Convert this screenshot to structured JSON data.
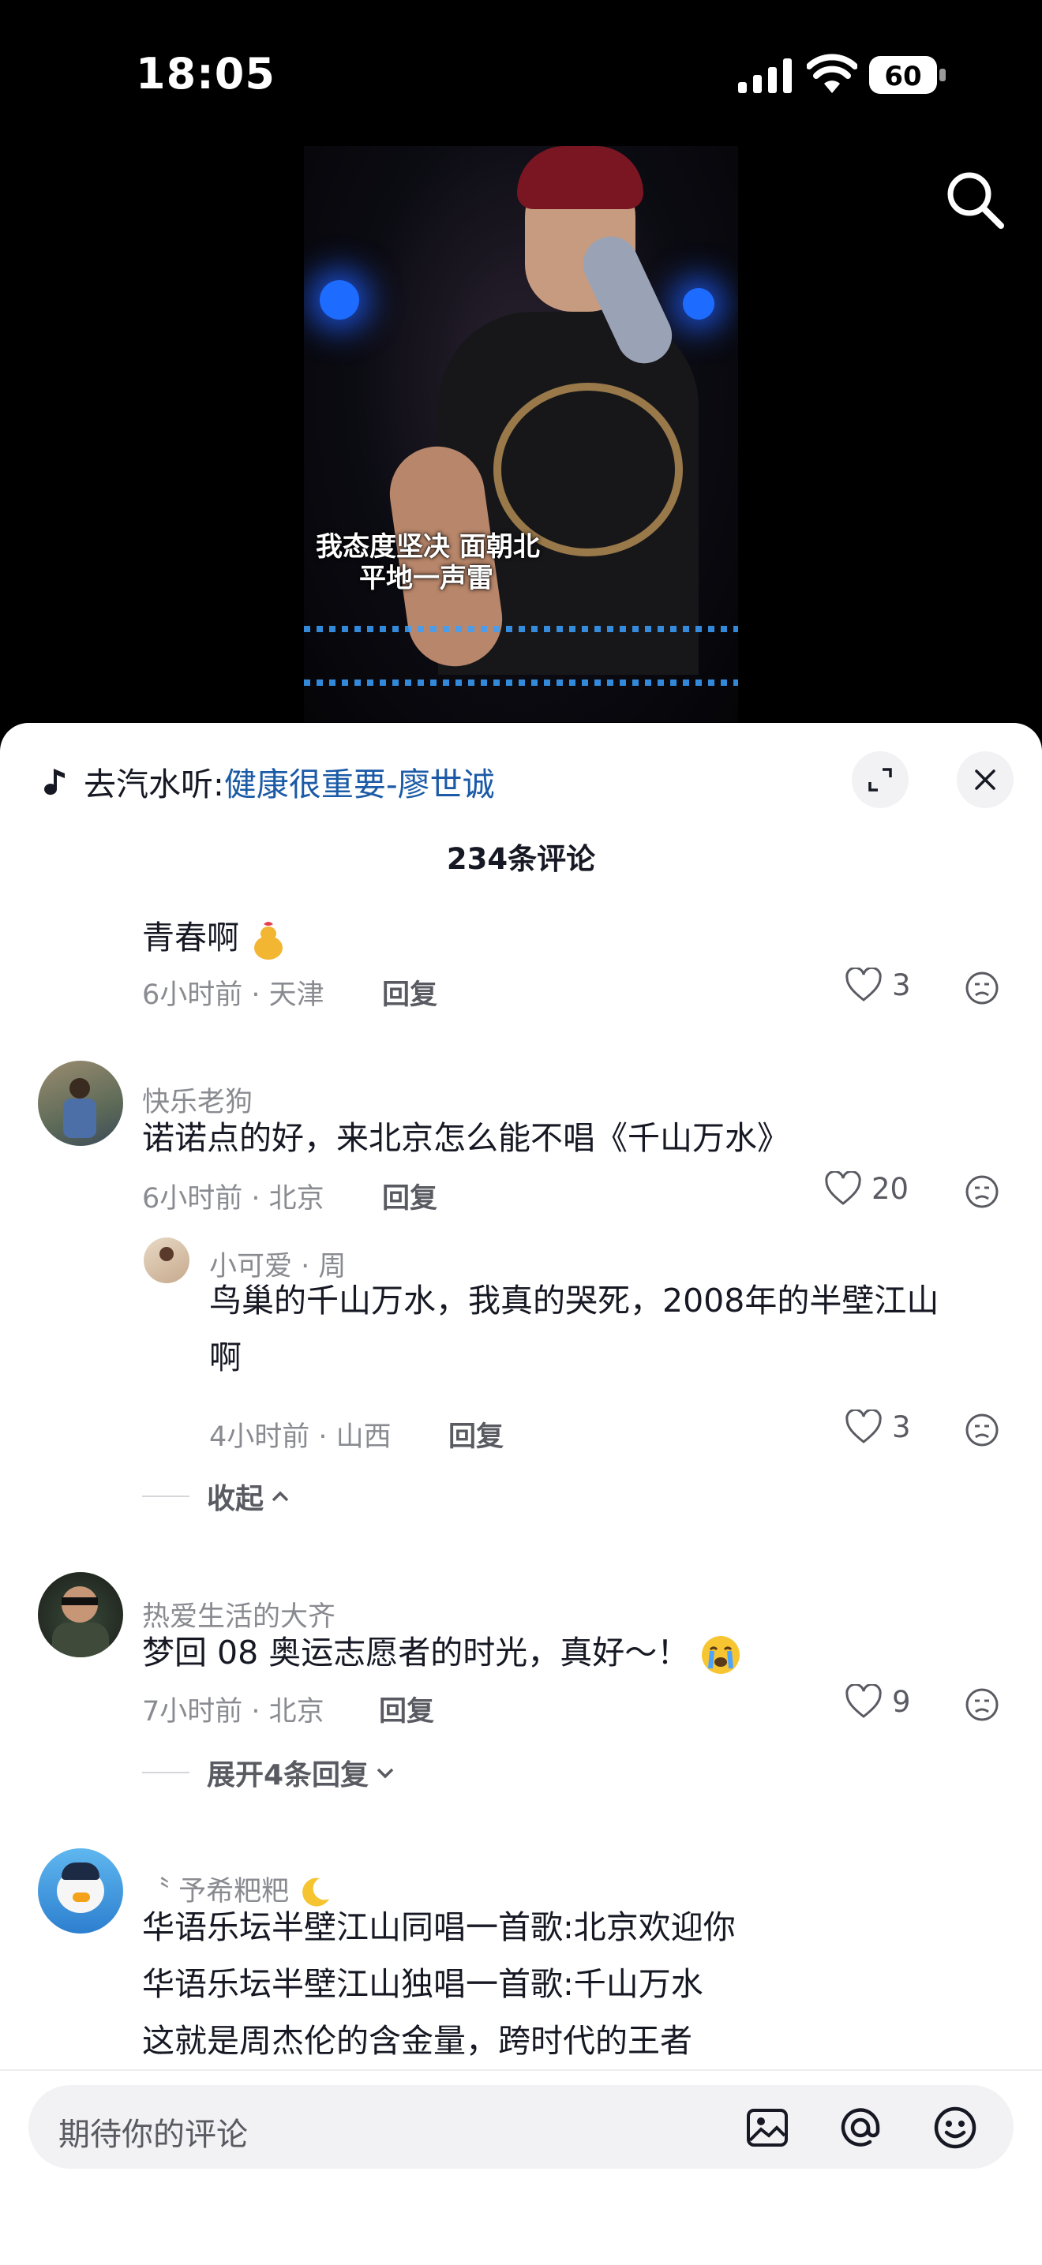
{
  "status_bar": {
    "time": "18:05",
    "battery": "60"
  },
  "video": {
    "lyric_line1": "我态度坚决 面朝北",
    "lyric_line2": "平地一声雷"
  },
  "sheet": {
    "music_prefix": "去汽水听:",
    "music_song": "健康很重要-廖世诚",
    "comment_count": "234条评论"
  },
  "comments": [
    {
      "text": "青春啊",
      "meta": "6小时前 · 天津",
      "reply": "回复",
      "likes": "3"
    },
    {
      "user": "快乐老狗",
      "text": "诺诺点的好，来北京怎么能不唱《千山万水》",
      "meta": "6小时前 · 北京",
      "reply": "回复",
      "likes": "20",
      "replies": [
        {
          "user": "小可爱 · 周",
          "text_line1": "鸟巢的千山万水，我真的哭死，2008年的半壁江山",
          "text_line2": "啊",
          "meta": "4小时前 · 山西",
          "reply": "回复",
          "likes": "3"
        }
      ],
      "toggle": "收起"
    },
    {
      "user": "热爱生活的大齐",
      "text": "梦回 08 奥运志愿者的时光，真好～！",
      "meta": "7小时前 · 北京",
      "reply": "回复",
      "likes": "9",
      "toggle": "展开4条回复"
    },
    {
      "user": "〝 予希粑粑",
      "lines": [
        "华语乐坛半壁江山同唱一首歌:北京欢迎你",
        "华语乐坛半壁江山独唱一首歌:千山万水",
        "这就是周杰伦的含金量，跨时代的王者"
      ]
    }
  ],
  "input": {
    "placeholder": "期待你的评论"
  },
  "colors": {
    "link": "#1b5aa6",
    "muted": "#8a8b91",
    "text": "#161823"
  }
}
